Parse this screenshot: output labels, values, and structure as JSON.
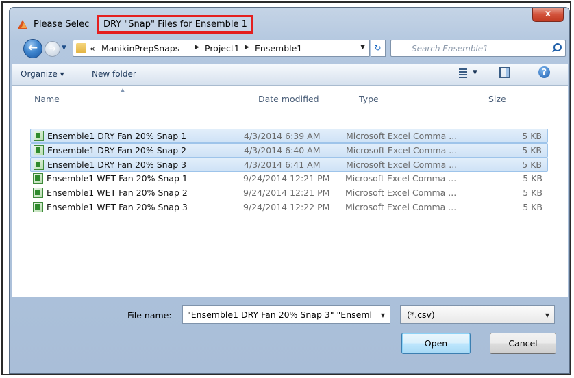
{
  "window": {
    "title_prefix": "Please Selec",
    "title_highlight": "DRY \"Snap\" Files for Ensemble 1",
    "close_label": "x"
  },
  "nav": {
    "back_glyph": "←",
    "forward_glyph": "→",
    "breadcrumb_root": "«",
    "breadcrumbs": [
      "ManikinPrepSnaps",
      "Project1",
      "Ensemble1"
    ],
    "search_placeholder": "Search Ensemble1"
  },
  "toolbar": {
    "organize_label": "Organize ▾",
    "new_folder_label": "New folder",
    "help_label": "?"
  },
  "columns": {
    "name": "Name",
    "date": "Date modified",
    "type": "Type",
    "size": "Size"
  },
  "files": [
    {
      "name": "Ensemble1 DRY Fan 20% Snap 1",
      "date": "4/3/2014 6:39 AM",
      "type": "Microsoft Excel Comma ...",
      "size": "5 KB",
      "selected": true
    },
    {
      "name": "Ensemble1 DRY Fan 20% Snap 2",
      "date": "4/3/2014 6:40 AM",
      "type": "Microsoft Excel Comma ...",
      "size": "5 KB",
      "selected": true
    },
    {
      "name": "Ensemble1 DRY Fan 20% Snap 3",
      "date": "4/3/2014 6:41 AM",
      "type": "Microsoft Excel Comma ...",
      "size": "5 KB",
      "selected": true
    },
    {
      "name": "Ensemble1 WET Fan 20% Snap 1",
      "date": "9/24/2014 12:21 PM",
      "type": "Microsoft Excel Comma ...",
      "size": "5 KB",
      "selected": false
    },
    {
      "name": "Ensemble1 WET Fan 20% Snap 2",
      "date": "9/24/2014 12:21 PM",
      "type": "Microsoft Excel Comma ...",
      "size": "5 KB",
      "selected": false
    },
    {
      "name": "Ensemble1 WET Fan 20% Snap 3",
      "date": "9/24/2014 12:22 PM",
      "type": "Microsoft Excel Comma ...",
      "size": "5 KB",
      "selected": false
    }
  ],
  "footer": {
    "filename_label": "File name:",
    "filename_value": "\"Ensemble1 DRY Fan 20% Snap 3\" \"Enseml",
    "filetype_value": "(*.csv)",
    "open_label": "Open",
    "cancel_label": "Cancel"
  },
  "colors": {
    "highlight_border": "#e41f1f",
    "selection": "#cfe2f6"
  }
}
